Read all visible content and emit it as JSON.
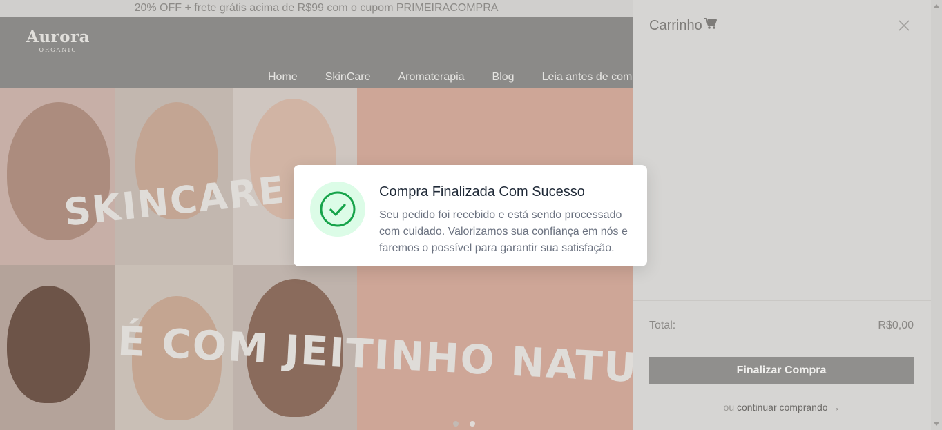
{
  "promo_bar": {
    "text": "20% OFF + frete grátis acima de R$99 com o cupom PRIMEIRACOMPRA"
  },
  "header": {
    "logo": {
      "name": "Aurora",
      "tagline": "ORGANIC"
    },
    "nav": [
      "Home",
      "SkinCare",
      "Aromaterapia",
      "Blog",
      "Leia antes de comprar"
    ]
  },
  "hero": {
    "text_line1": "SKINCARE",
    "text_line2": "É COM JEITINHO NATURAL",
    "slides_total": 2,
    "slide_active": 2
  },
  "cart": {
    "title": "Carrinho",
    "total_label": "Total:",
    "total_value": "R$0,00",
    "checkout_label": "Finalizar Compra",
    "continue_prefix": "ou",
    "continue_link": "continuar comprando →"
  },
  "modal": {
    "title": "Compra Finalizada Com Sucesso",
    "message": "Seu pedido foi recebido e está sendo processado com cuidado. Valorizamos sua confiança em nós e faremos o possível para garantir sua satisfação.",
    "icon": "check-icon"
  },
  "colors": {
    "success_green": "#16a34a",
    "success_bg": "#dcfce7",
    "drawer_bg": "#d6d5d3",
    "checkout_button": "#908f8d"
  }
}
